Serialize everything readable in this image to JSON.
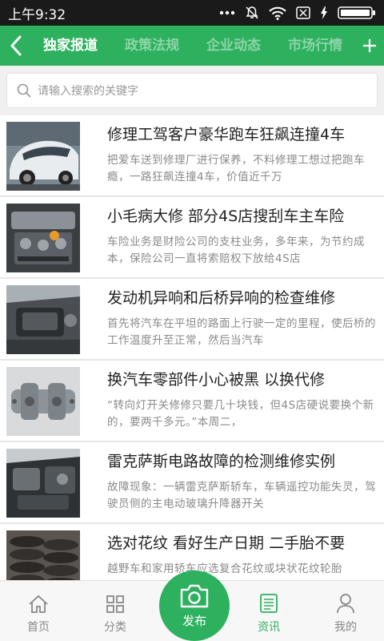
{
  "status": {
    "time": "上午9:32"
  },
  "nav": {
    "tabs": [
      "独家报道",
      "政策法规",
      "企业动态",
      "市场行情"
    ],
    "active": 0
  },
  "search": {
    "placeholder": "请输入搜索的关键字"
  },
  "articles": [
    {
      "title": "修理工驾客户豪华跑车狂飙连撞4车",
      "desc": "把爱车送到修理厂进行保养，不料修理工想过把跑车瘾，一路狂飙连撞4车，价值近千万",
      "thumb": "supercar"
    },
    {
      "title": "小毛病大修 部分4S店搜刮车主车险",
      "desc": "车险业务是财险公司的支柱业务，多年来，为节约成本，保险公司一直将索赔权下放给4S店",
      "thumb": "engine"
    },
    {
      "title": "发动机异响和后桥异响的检查维修",
      "desc": "首先将汽车在平坦的路面上行驶一定的里程，使后桥的工作温度升至正常，然后当汽车",
      "thumb": "engine-bay"
    },
    {
      "title": "换汽车零部件小心被黑 以换代修",
      "desc": "“转向灯开关修修只要几十块钱，但4S店硬说要换个新的，要两千多元。”本周二，",
      "thumb": "part"
    },
    {
      "title": "雷克萨斯电路故障的检测维修实例",
      "desc": "故障现象：一辆雷克萨斯轿车，车辆遥控功能失灵，驾驶员侧的主电动玻璃升降器开关",
      "thumb": "engine2"
    },
    {
      "title": "选对花纹 看好生产日期 二手胎不要",
      "desc": "越野车和家用轿车应选复合花纹或块状花纹轮胎",
      "thumb": "tires"
    }
  ],
  "bottom_nav": [
    {
      "label": "首页",
      "icon": "home-icon"
    },
    {
      "label": "分类",
      "icon": "grid-icon"
    },
    {
      "label": "发布",
      "icon": "camera-icon"
    },
    {
      "label": "资讯",
      "icon": "news-icon"
    },
    {
      "label": "我的",
      "icon": "user-icon"
    }
  ],
  "colors": {
    "accent": "#2eb15f",
    "statusbar": "#1a1a1a"
  }
}
